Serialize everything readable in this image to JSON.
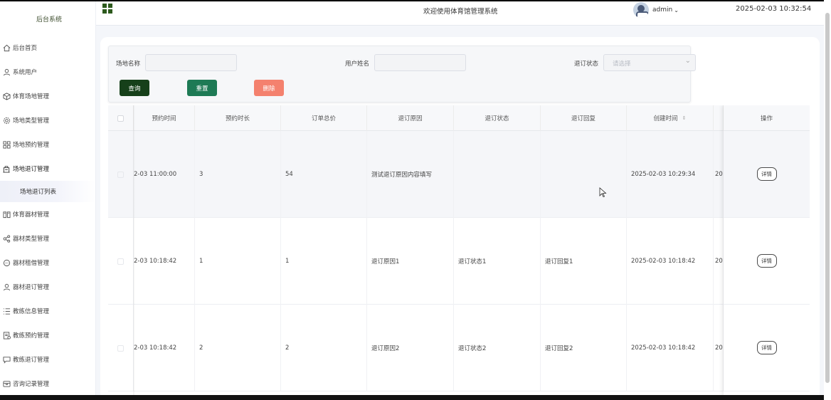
{
  "sidebar": {
    "brand": "后台系统",
    "items": [
      {
        "label": "后台首页",
        "icon": "home-icon"
      },
      {
        "label": "系统用户",
        "icon": "user-icon"
      },
      {
        "label": "体育场地管理",
        "icon": "cube-icon"
      },
      {
        "label": "场地类型管理",
        "icon": "gear-icon"
      },
      {
        "label": "场地预约管理",
        "icon": "grid-icon"
      },
      {
        "label": "场地退订管理",
        "icon": "building-icon"
      },
      {
        "label": "体育器材管理",
        "icon": "book-icon"
      },
      {
        "label": "器材类型管理",
        "icon": "share-icon"
      },
      {
        "label": "器材租借管理",
        "icon": "chat-icon"
      },
      {
        "label": "器材退订管理",
        "icon": "person-icon"
      },
      {
        "label": "教练信息管理",
        "icon": "list-icon"
      },
      {
        "label": "教练预约管理",
        "icon": "doc-icon"
      },
      {
        "label": "教练退订管理",
        "icon": "comment-icon"
      },
      {
        "label": "咨询记录管理",
        "icon": "box-icon"
      }
    ],
    "sub_item": "场地退订列表"
  },
  "header": {
    "welcome": "欢迎使用体育馆管理系统",
    "username": "admin",
    "datetime": "2025-02-03 10:32:54"
  },
  "search": {
    "venue_label": "场地名称",
    "user_label": "用户姓名",
    "status_label": "退订状态",
    "status_placeholder": "请选择",
    "query_btn": "查询",
    "reset_btn": "重置",
    "delete_btn": "删除"
  },
  "colors": {
    "query": "#16401a",
    "reset": "#1e7a55",
    "delete": "#f4816e"
  },
  "table": {
    "headers": [
      "预约时间",
      "预约时长",
      "订单总价",
      "退订原因",
      "退订状态",
      "退订回复",
      "创建时间",
      "操作"
    ],
    "rows": [
      {
        "time": "2-03 11:00:00",
        "duration": "3",
        "price": "54",
        "reason": "测试退订原因内容填写",
        "status": "",
        "reply": "",
        "created": "2025-02-03 10:29:34",
        "extra": "20",
        "action": "详情"
      },
      {
        "time": "2-03 10:18:42",
        "duration": "1",
        "price": "1",
        "reason": "退订原因1",
        "status": "退订状态1",
        "reply": "退订回复1",
        "created": "2025-02-03 10:18:42",
        "extra": "20",
        "action": "详情"
      },
      {
        "time": "2-03 10:18:42",
        "duration": "2",
        "price": "2",
        "reason": "退订原因2",
        "status": "退订状态2",
        "reply": "退订回复2",
        "created": "2025-02-03 10:18:42",
        "extra": "20",
        "action": "详情"
      }
    ]
  }
}
